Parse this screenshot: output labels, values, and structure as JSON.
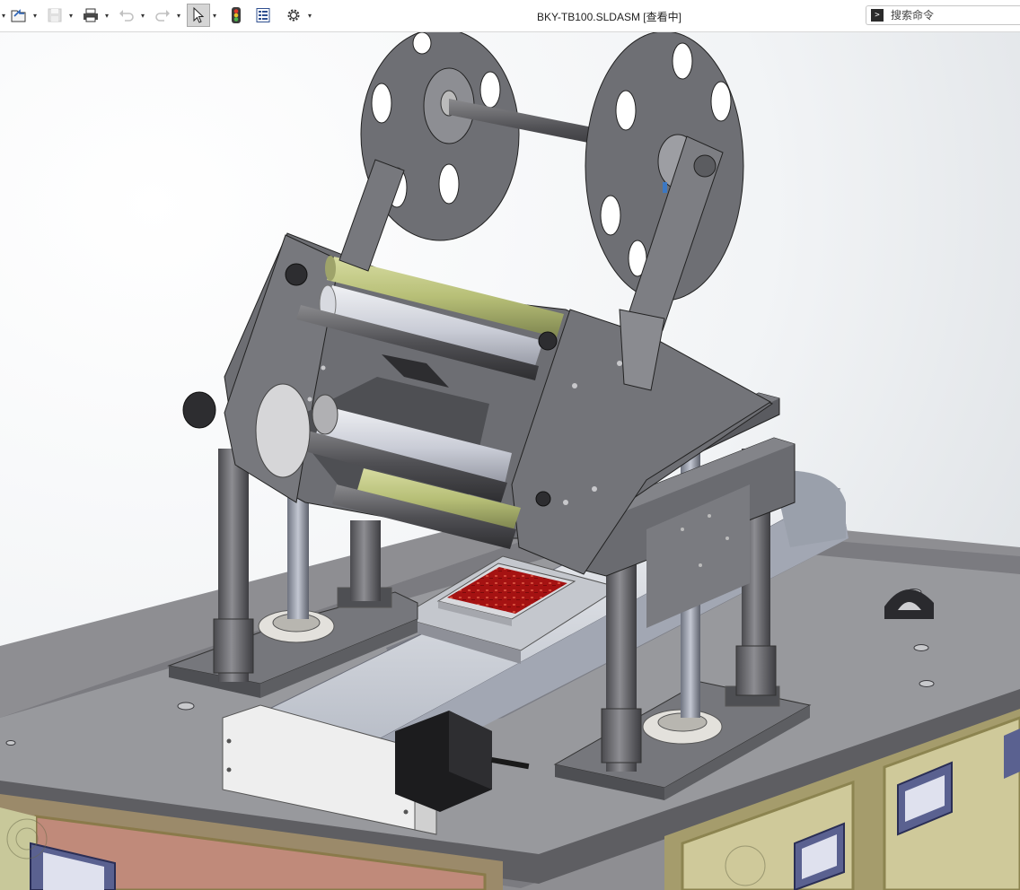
{
  "window": {
    "title": "BKY-TB100.SLDASM [查看中]"
  },
  "toolbar": {
    "items": [
      {
        "name": "open",
        "icon": "open-folder-icon"
      },
      {
        "name": "save",
        "icon": "save-icon",
        "disabled": true
      },
      {
        "name": "print",
        "icon": "print-icon"
      },
      {
        "name": "undo",
        "icon": "undo-icon",
        "disabled": true
      },
      {
        "name": "redo",
        "icon": "redo-icon",
        "disabled": true
      },
      {
        "name": "select",
        "icon": "cursor-icon",
        "active": true
      },
      {
        "name": "rebuild",
        "icon": "traffic-light-icon"
      },
      {
        "name": "file-properties",
        "icon": "properties-icon"
      },
      {
        "name": "options",
        "icon": "gear-icon"
      }
    ]
  },
  "search": {
    "placeholder": "搜索命令"
  },
  "heads_up_toolbar": {
    "items": [
      "zoom-to-fit-icon",
      "zoom-to-area-icon",
      "previous-view-icon",
      "section-view-icon",
      "view-orientation-icon",
      "display-style-icon",
      "hide-show-icon",
      "edit-appearance-icon",
      "apply-scene-icon",
      "view-settings-icon"
    ]
  },
  "model": {
    "name": "BKY-TB100",
    "type": "assembly"
  },
  "colors": {
    "accent": "#3c78c3",
    "metal": "#7a7a7e",
    "roller_yellow": "#b8c07a",
    "pcb_red": "#a01010",
    "panel_brown": "#b08070"
  }
}
